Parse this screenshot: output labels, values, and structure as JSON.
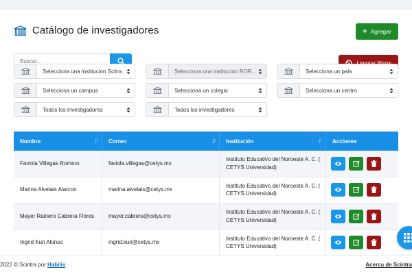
{
  "page": {
    "title": "Catálogo de investigadores",
    "add_label": "Agregar",
    "clear_label": "Limpiar filtros",
    "search_placeholder": "Buscar..."
  },
  "filters": [
    {
      "label": "Selecciona una institucion Scitra",
      "disabled": false
    },
    {
      "label": "Selecciona una institución ROR...",
      "disabled": true
    },
    {
      "label": "Selecciona un país",
      "disabled": false
    },
    {
      "label": "Selecciona un campus",
      "disabled": false
    },
    {
      "label": "Selecciona un colegio",
      "disabled": false
    },
    {
      "label": "Selecciona un centro",
      "disabled": false
    },
    {
      "label": "Todos los investigadores",
      "disabled": false
    },
    {
      "label": "Todos los investigadores",
      "disabled": false
    }
  ],
  "table": {
    "headers": [
      "Nombre",
      "Correo",
      "Institución",
      "Acciones"
    ],
    "rows": [
      {
        "name": "Faviola Villegas Romero",
        "email": "faviola.villegas@cetys.mx",
        "inst": "Instituto Educativo del Noroeste A. C. ( CETYS Universidad)"
      },
      {
        "name": "Marina Alvelais Alarcon",
        "email": "marina.alvelais@cetys.mx",
        "inst": "Instituto Educativo del Noroeste A. C. ( CETYS Universidad)"
      },
      {
        "name": "Mayer Rainero Cabrera Flores",
        "email": "mayer.cabrera@cetys.mx",
        "inst": "Instituto Educativo del Noroeste A. C. ( CETYS Universidad)"
      },
      {
        "name": "Ingrid Kuri Alonso",
        "email": "ingrid.kuri@cetys.mx",
        "inst": "Instituto Educativo del Noroeste A. C. ( CETYS Universidad)"
      }
    ]
  },
  "footer": {
    "copyright": "2022 © Scintra por ",
    "brand_link": "Habilis",
    "about_link": "Acerca de Scintra"
  },
  "colors": {
    "primary": "#1a8fe6",
    "success": "#1e8a2a",
    "danger": "#9a1515"
  },
  "icons": {
    "title": "building-columns-icon",
    "filter_addon": "institution-icon",
    "view": "eye-icon",
    "edit": "edit-icon",
    "delete": "trash-icon",
    "fab": "grid-icon"
  }
}
